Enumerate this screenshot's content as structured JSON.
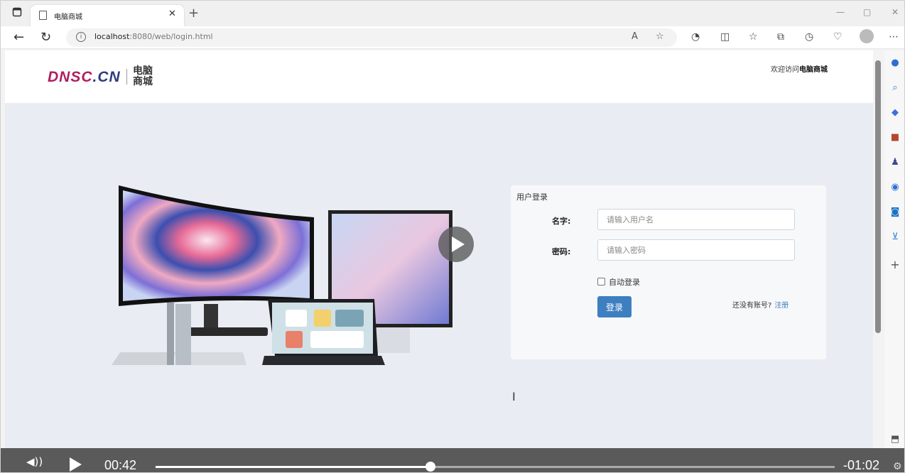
{
  "browser": {
    "tab_title": "电脑商城",
    "url_host": "localhost",
    "url_rest": ":8080/web/login.html"
  },
  "header": {
    "logo_a": "DNSC",
    "logo_b": ".CN",
    "logo_cn": "电脑商城",
    "welcome_prefix": "欢迎访问",
    "welcome_site": "电脑商城"
  },
  "login": {
    "panel_title": "用户登录",
    "name_label": "名字:",
    "name_placeholder": "请输入用户名",
    "password_label": "密码:",
    "password_placeholder": "请输入密码",
    "remember_label": "自动登录",
    "login_button": "登录",
    "register_prompt": "还没有账号?",
    "register_link": "注册"
  },
  "video": {
    "elapsed": "00:42",
    "remaining": "-01:02",
    "progress": 0.405
  },
  "colors": {
    "accent": "#3d7fc0",
    "logo_red": "#b01e5e",
    "logo_navy": "#2c3d7a"
  }
}
